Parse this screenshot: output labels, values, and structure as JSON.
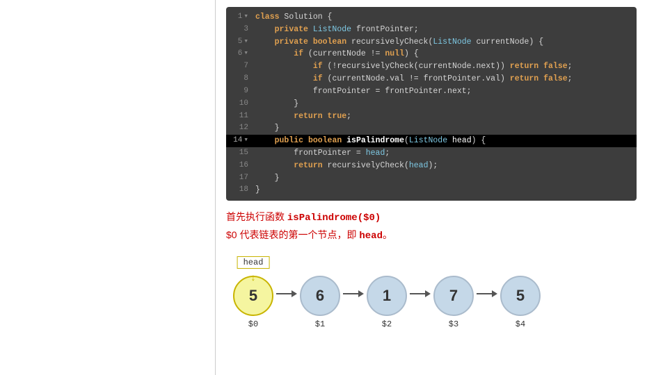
{
  "left_panel": {},
  "code": {
    "lines": [
      {
        "num": "1",
        "arrow": true,
        "content": "class Solution {",
        "highlight": false
      },
      {
        "num": "3",
        "arrow": false,
        "content": "    private ListNode frontPointer;",
        "highlight": false
      },
      {
        "num": "5",
        "arrow": true,
        "content": "    private boolean recursivelyCheck(ListNode currentNode) {",
        "highlight": false
      },
      {
        "num": "6",
        "arrow": true,
        "content": "        if (currentNode != null) {",
        "highlight": false
      },
      {
        "num": "7",
        "arrow": false,
        "content": "            if (!recursivelyCheck(currentNode.next)) return false;",
        "highlight": false
      },
      {
        "num": "8",
        "arrow": false,
        "content": "            if (currentNode.val != frontPointer.val) return false;",
        "highlight": false
      },
      {
        "num": "9",
        "arrow": false,
        "content": "            frontPointer = frontPointer.next;",
        "highlight": false
      },
      {
        "num": "10",
        "arrow": false,
        "content": "        }",
        "highlight": false
      },
      {
        "num": "11",
        "arrow": false,
        "content": "        return true;",
        "highlight": false
      },
      {
        "num": "12",
        "arrow": false,
        "content": "    }",
        "highlight": false
      },
      {
        "num": "14",
        "arrow": true,
        "content": "    public boolean isPalindrome(ListNode head) {",
        "highlight": true
      },
      {
        "num": "15",
        "arrow": false,
        "content": "        frontPointer = head;",
        "highlight": false
      },
      {
        "num": "16",
        "arrow": false,
        "content": "        return recursivelyCheck(head);",
        "highlight": false
      },
      {
        "num": "17",
        "arrow": false,
        "content": "    }",
        "highlight": false
      },
      {
        "num": "18",
        "arrow": false,
        "content": "}",
        "highlight": false
      }
    ]
  },
  "description": {
    "line1": "首先执行函数 isPalindrome($0)",
    "line2": "$0 代表链表的第一个节点，即 head。"
  },
  "diagram": {
    "head_label": "head",
    "nodes": [
      {
        "value": "5",
        "index": "$0",
        "highlighted": true
      },
      {
        "value": "6",
        "index": "$1",
        "highlighted": false
      },
      {
        "value": "1",
        "index": "$2",
        "highlighted": false
      },
      {
        "value": "7",
        "index": "$3",
        "highlighted": false
      },
      {
        "value": "5",
        "index": "$4",
        "highlighted": false
      }
    ]
  }
}
